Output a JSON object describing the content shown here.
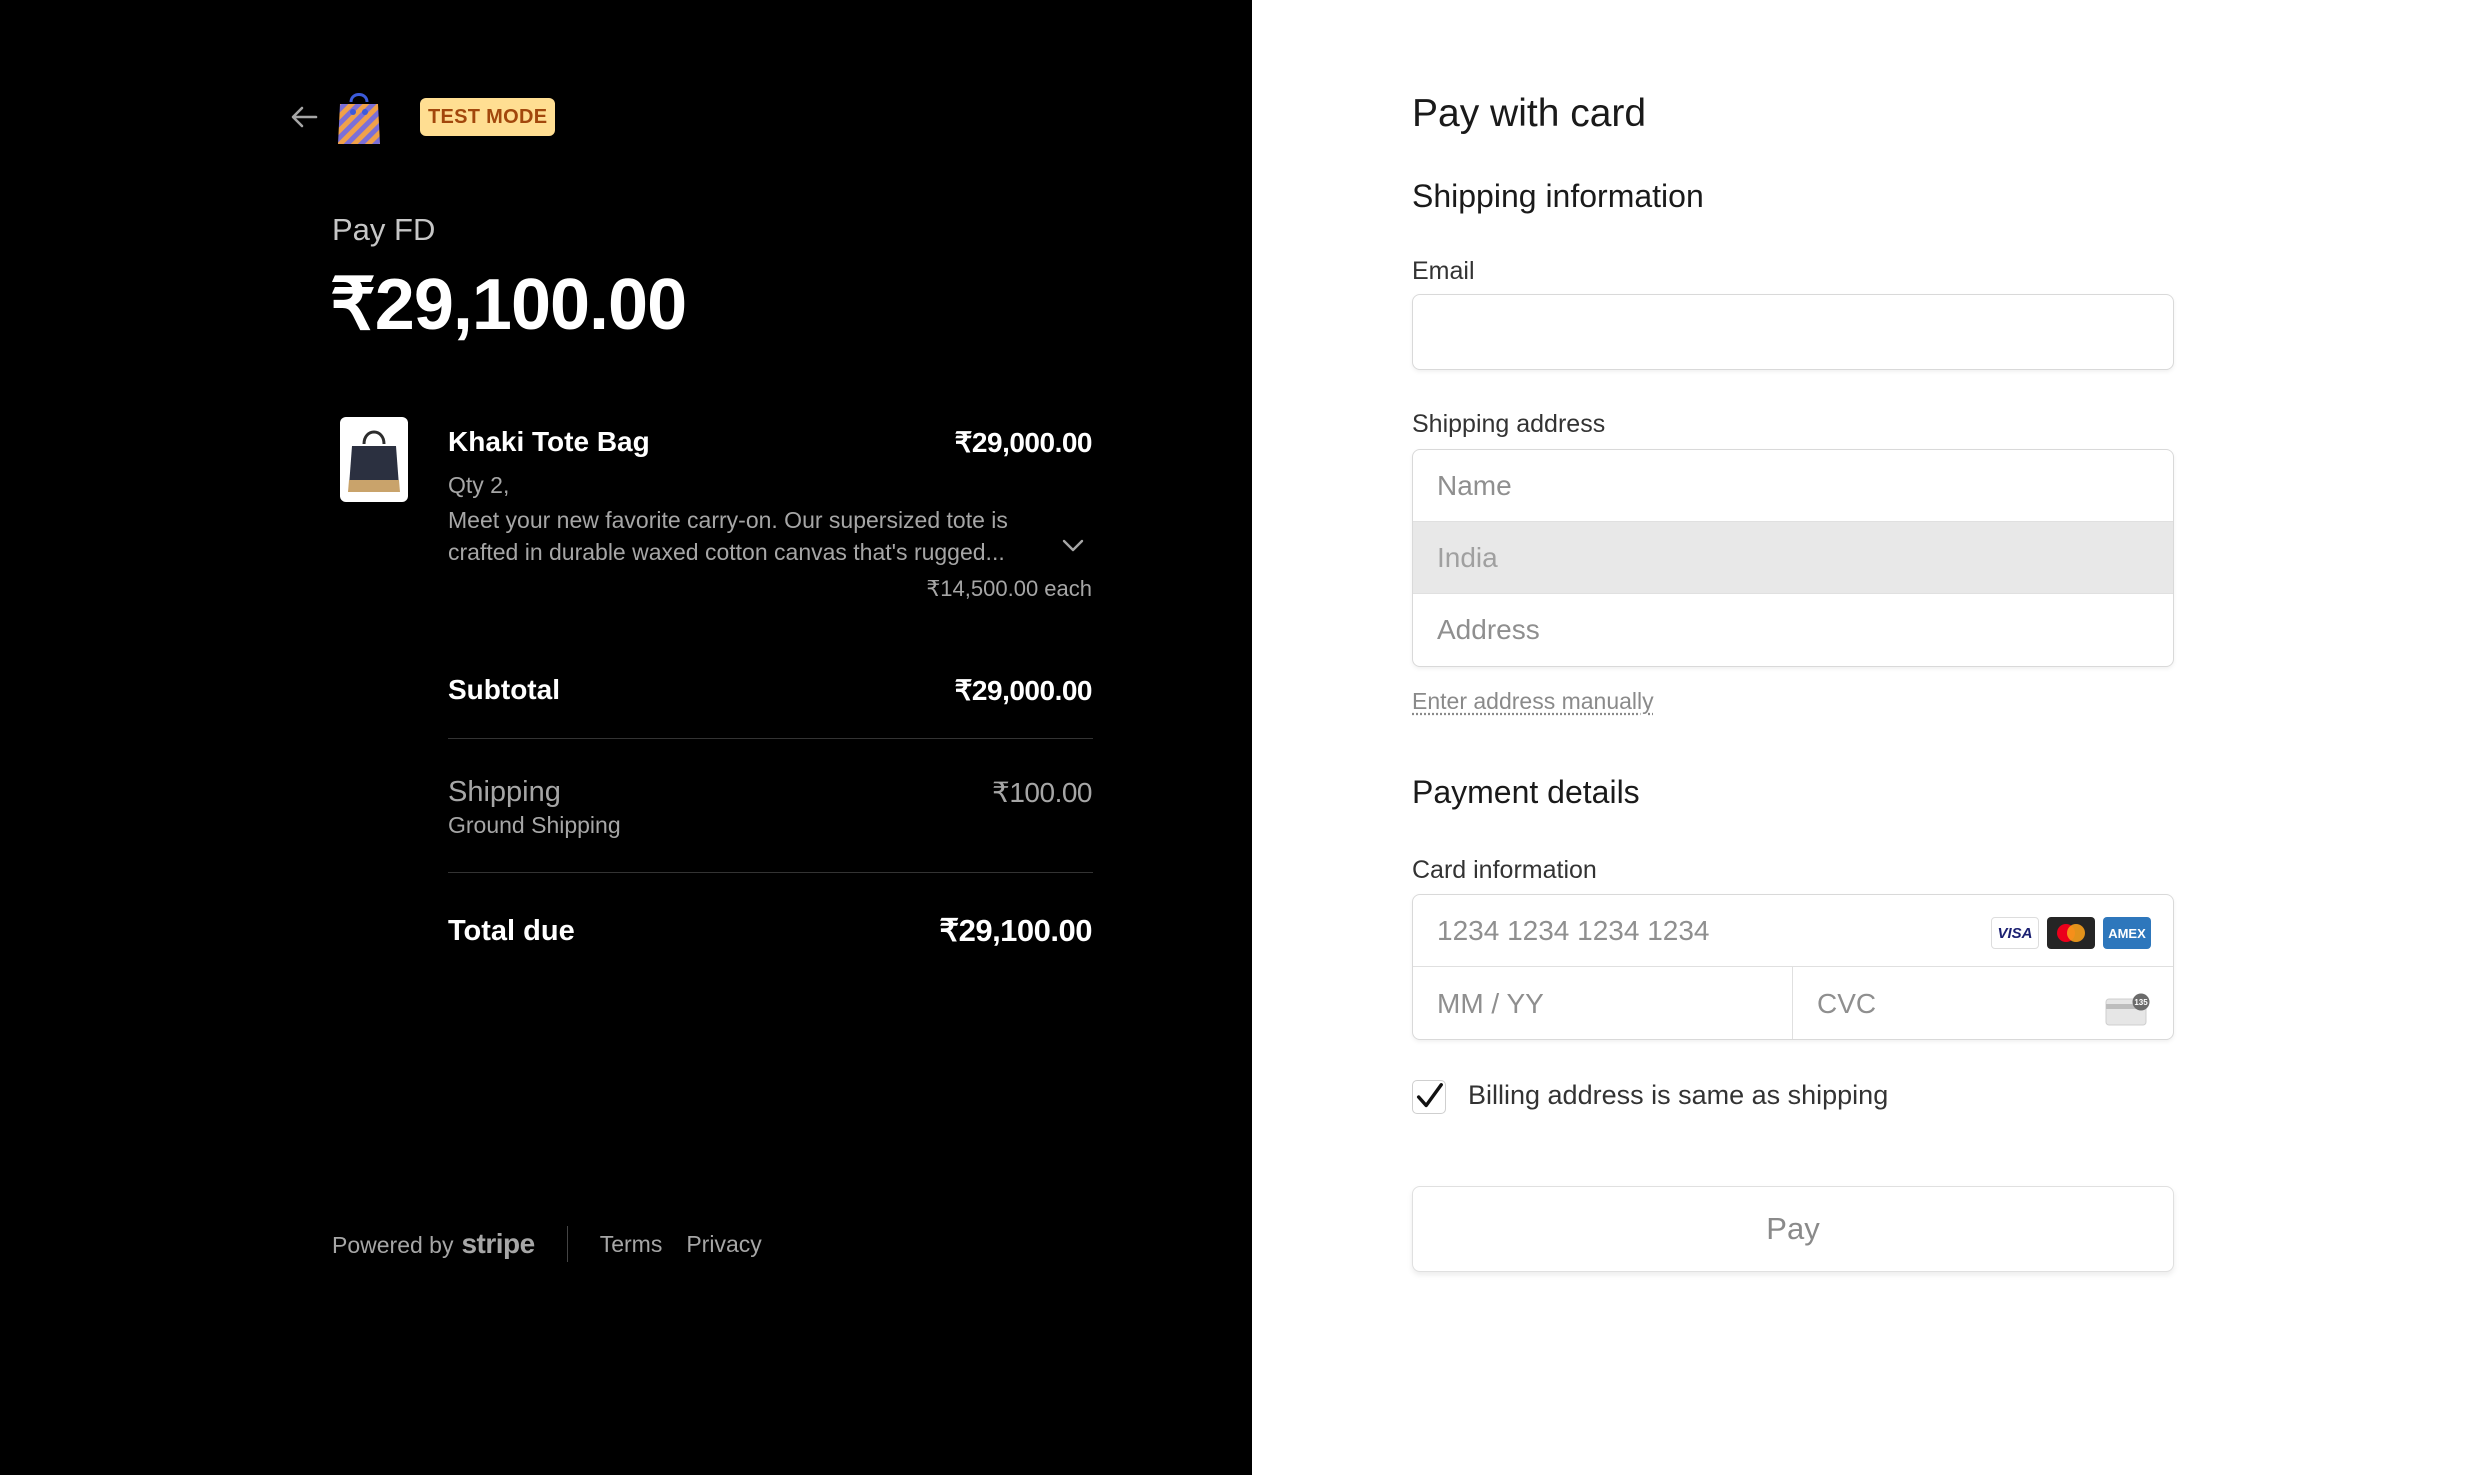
{
  "header": {
    "test_mode_label": "TEST MODE",
    "back_icon": "arrow-left-icon",
    "logo_icon": "shopping-bag-icon"
  },
  "summary": {
    "title": "Pay FD",
    "amount": "₹29,100.00"
  },
  "product": {
    "name": "Khaki Tote Bag",
    "price": "₹29,000.00",
    "qty": "Qty 2,",
    "description": "Meet your new favorite carry-on. Our supersized tote is crafted in durable waxed cotton canvas that's rugged...",
    "each": "₹14,500.00 each"
  },
  "totals": {
    "subtotal_label": "Subtotal",
    "subtotal_value": "₹29,000.00",
    "shipping_label": "Shipping",
    "shipping_method": "Ground Shipping",
    "shipping_value": "₹100.00",
    "total_label": "Total due",
    "total_value": "₹29,100.00"
  },
  "footer": {
    "powered_by": "Powered by",
    "stripe": "stripe",
    "terms": "Terms",
    "privacy": "Privacy"
  },
  "form": {
    "heading": "Pay with card",
    "shipping_heading": "Shipping information",
    "email_label": "Email",
    "email_value": "",
    "shipping_address_label": "Shipping address",
    "name_placeholder": "Name",
    "country_value": "India",
    "address_placeholder": "Address",
    "manual_link": "Enter address manually",
    "payment_heading": "Payment details",
    "card_label": "Card information",
    "card_placeholder": "1234 1234 1234 1234",
    "brands": [
      "VISA",
      "Mastercard",
      "AMEX"
    ],
    "exp_placeholder": "MM / YY",
    "cvc_placeholder": "CVC",
    "cvc_badge": "135",
    "billing_same_label": "Billing address is same as shipping",
    "billing_same_checked": true,
    "pay_button": "Pay"
  },
  "colors": {
    "left_bg": "#000000",
    "right_bg": "#ffffff",
    "badge_bg": "#ffde92",
    "badge_text": "#a2470c"
  }
}
